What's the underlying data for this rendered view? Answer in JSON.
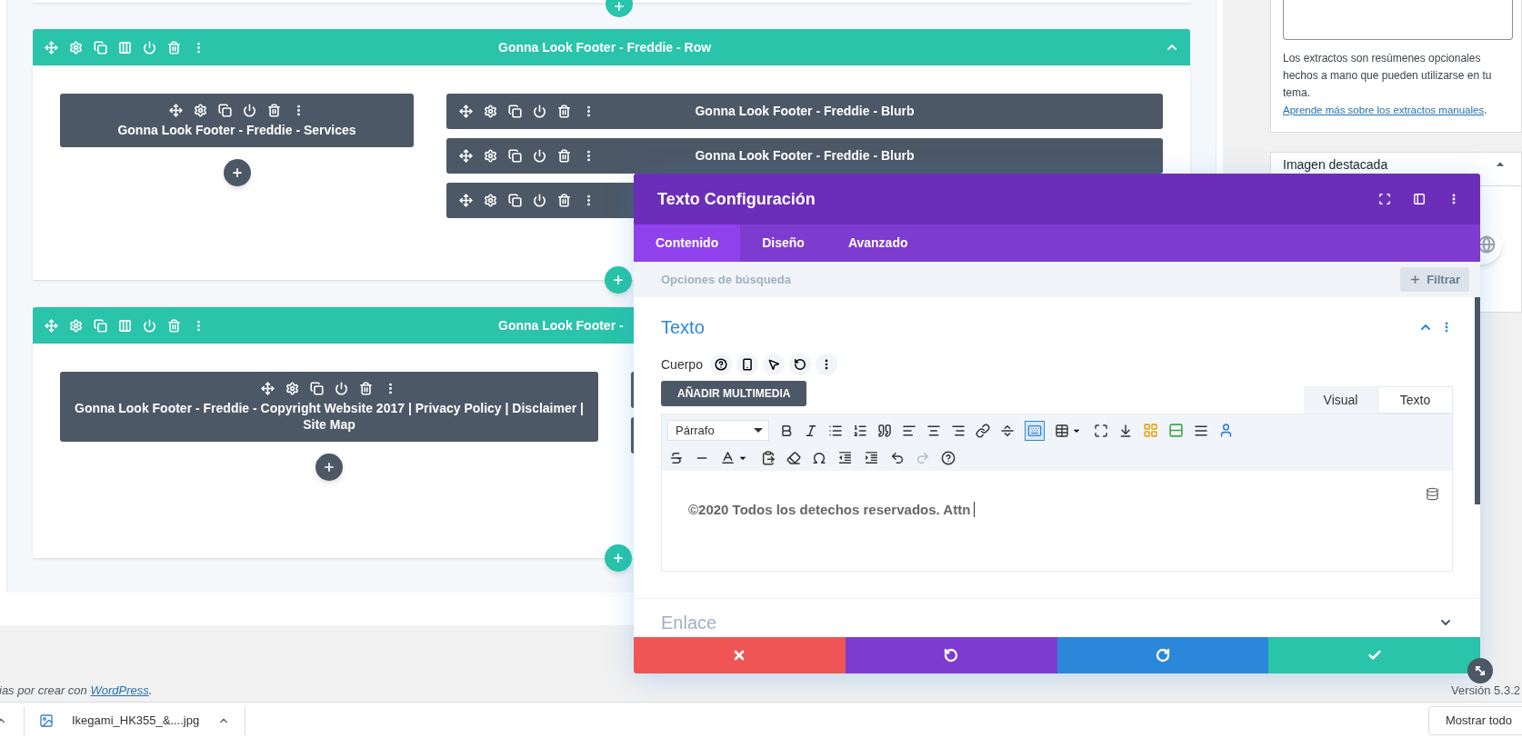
{
  "builder": {
    "rows": [
      {
        "title": "Gonna Look Footer - Freddie - Row",
        "expanded": true,
        "columns": [
          {
            "modules": [
              {
                "kind": "stacked",
                "title": "Gonna Look Footer - Freddie - Services"
              }
            ]
          },
          {
            "modules": [
              {
                "kind": "inline",
                "title": "Gonna Look Footer - Freddie - Blurb"
              },
              {
                "kind": "inline",
                "title": "Gonna Look Footer - Freddie - Blurb"
              },
              {
                "kind": "inline"
              }
            ]
          }
        ]
      },
      {
        "title": "Gonna Look Footer -",
        "columns": [
          {
            "modules": [
              {
                "kind": "stacked",
                "title": "Gonna Look Footer - Freddie - Copyright Website 2017 | Privacy Policy | Disclaimer | Site Map"
              }
            ]
          },
          {
            "modules": [
              {
                "kind": "covered"
              },
              {
                "kind": "covered"
              }
            ]
          }
        ]
      }
    ]
  },
  "sidebar": {
    "excerpt_help": "Los extractos son resúmenes opcionales hechos a mano que pueden utilizarse en tu tema.",
    "excerpt_link": "Aprende más sobre los extractos manuales",
    "excerpt_after": ".",
    "featured_image": {
      "title": "Imagen destacada",
      "expanded": true
    }
  },
  "footer": {
    "credit_before": "ias por crear con",
    "credit_link": "WordPress",
    "credit_after": ".",
    "version": "Versión 5.3.2"
  },
  "settings_modal": {
    "title": "Texto Configuración",
    "tabs": [
      {
        "label": "Contenido",
        "selected": true
      },
      {
        "label": "Diseño",
        "selected": false
      },
      {
        "label": "Avanzado",
        "selected": false
      }
    ],
    "search_placeholder": "Opciones de búsqueda",
    "filter_button": "Filtrar",
    "sections": [
      {
        "title": "Texto",
        "expanded": true
      },
      {
        "title": "Enlace",
        "expanded": false
      }
    ],
    "field_label": "Cuerpo",
    "media_button": "AÑADIR MULTIMEDIA",
    "editor_tabs": [
      {
        "label": "Visual",
        "selected": true
      },
      {
        "label": "Texto",
        "selected": false
      }
    ],
    "format_select": "Párrafo",
    "redo_disabled": true,
    "content": "©2020 Todos los detechos reservados. Attn"
  },
  "download_bar": {
    "file": "Ikegami_HK355_&....jpg",
    "show_all": "Mostrar todo"
  }
}
